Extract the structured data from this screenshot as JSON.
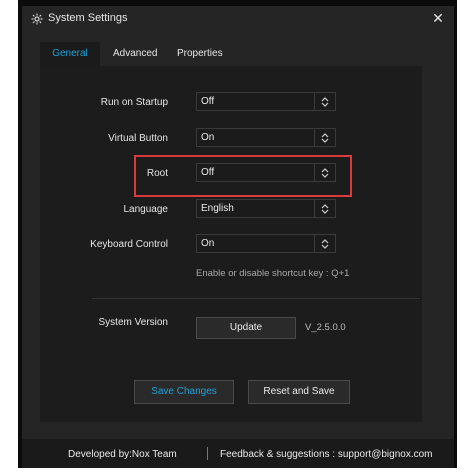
{
  "window": {
    "title": "System Settings",
    "close_symbol": "✕",
    "app_icon": "gear-icon"
  },
  "tabs": [
    {
      "label": "General",
      "active": true
    },
    {
      "label": "Advanced",
      "active": false
    },
    {
      "label": "Properties",
      "active": false
    }
  ],
  "settings": {
    "startup": {
      "label": "Run on Startup",
      "value": "Off"
    },
    "virtual_button": {
      "label": "Virtual Button",
      "value": "On"
    },
    "root": {
      "label": "Root",
      "value": "Off"
    },
    "language": {
      "label": "Language",
      "value": "English"
    },
    "keyboard": {
      "label": "Keyboard Control",
      "value": "On",
      "hint": "Enable or disable shortcut key : Q+1"
    }
  },
  "version": {
    "label": "System Version",
    "button": "Update",
    "value": "V_2.5.0.0"
  },
  "actions": {
    "save": "Save Changes",
    "reset": "Reset and Save"
  },
  "footer": {
    "developer": "Developed by:Nox Team",
    "feedback": "Feedback & suggestions : support@bignox.com"
  },
  "colors": {
    "accent": "#1ea1d6",
    "highlight": "#d93a3a",
    "background": "#252525"
  }
}
